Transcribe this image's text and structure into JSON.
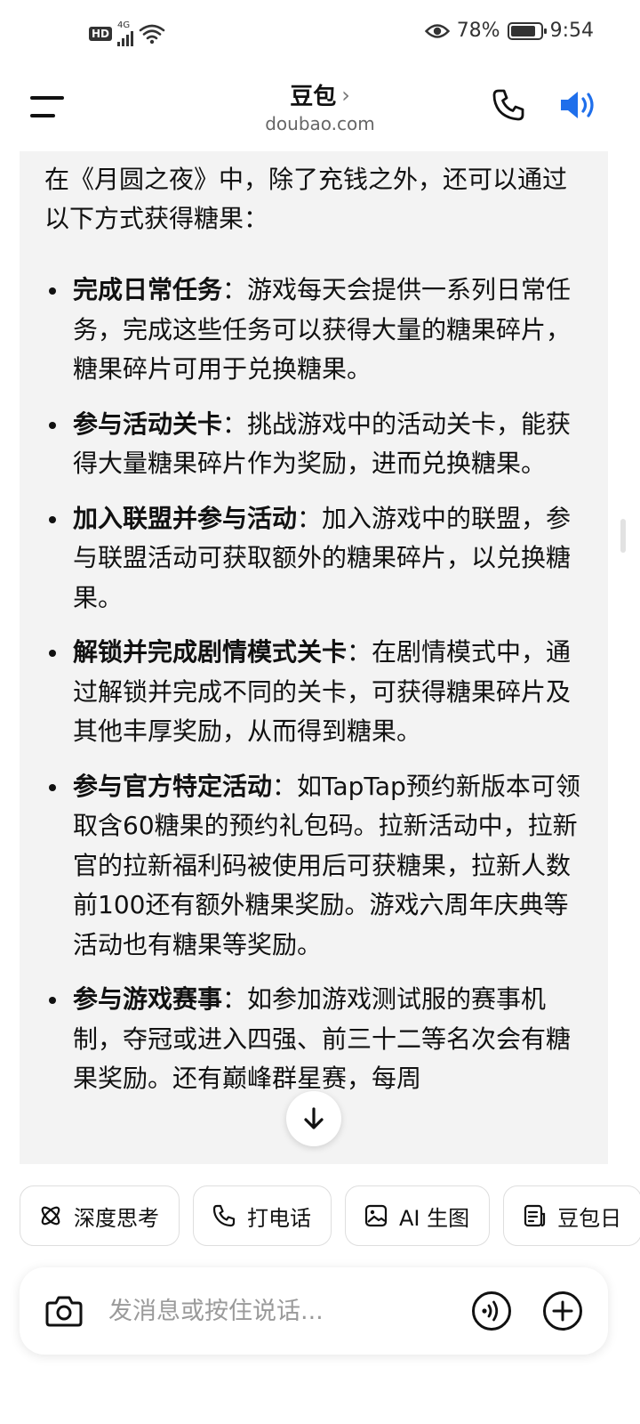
{
  "status_bar": {
    "hd_label": "HD",
    "network": "4G",
    "eye_icon": "eye-icon",
    "battery_percent": "78%",
    "battery_level": 0.78,
    "time": "9:54"
  },
  "header": {
    "title": "豆包",
    "title_chevron": "›",
    "subtitle": "doubao.com",
    "icons": [
      "menu-icon",
      "phone-icon",
      "speaker-icon"
    ],
    "speaker_color": "#1f6feb"
  },
  "message": {
    "intro": "在《月圆之夜》中，除了充钱之外，还可以通过以下方式获得糖果：",
    "items": [
      {
        "title": "完成日常任务",
        "text": "：游戏每天会提供一系列日常任务，完成这些任务可以获得大量的糖果碎片，糖果碎片可用于兑换糖果。"
      },
      {
        "title": "参与活动关卡",
        "text": "：挑战游戏中的活动关卡，能获得大量糖果碎片作为奖励，进而兑换糖果。"
      },
      {
        "title": "加入联盟并参与活动",
        "text": "：加入游戏中的联盟，参与联盟活动可获取额外的糖果碎片，以兑换糖果。"
      },
      {
        "title": "解锁并完成剧情模式关卡",
        "text": "：在剧情模式中，通过解锁并完成不同的关卡，可获得糖果碎片及其他丰厚奖励，从而得到糖果。"
      },
      {
        "title": "参与官方特定活动",
        "text": "：如TapTap预约新版本可领取含60糖果的预约礼包码。拉新活动中，拉新官的拉新福利码被使用后可获糖果，拉新人数前100还有额外糖果奖励。游戏六周年庆典等活动也有糖果等奖励。"
      },
      {
        "title": "参与游戏赛事",
        "text": "：如参加游戏测试服的赛事机制，夺冠或进入四强、前三十二等名次会有糖果奖励。还有巅峰群星赛，每周"
      }
    ]
  },
  "scroll_down_icon": "arrow-down-icon",
  "chips": [
    {
      "label": "深度思考",
      "icon": "atom-icon"
    },
    {
      "label": "打电话",
      "icon": "phone-icon"
    },
    {
      "label": "AI 生图",
      "icon": "image-icon"
    },
    {
      "label": "豆包日",
      "icon": "document-icon"
    }
  ],
  "input": {
    "placeholder": "发消息或按住说话...",
    "icons": [
      "camera-icon",
      "voice-wave-icon",
      "plus-icon"
    ]
  }
}
